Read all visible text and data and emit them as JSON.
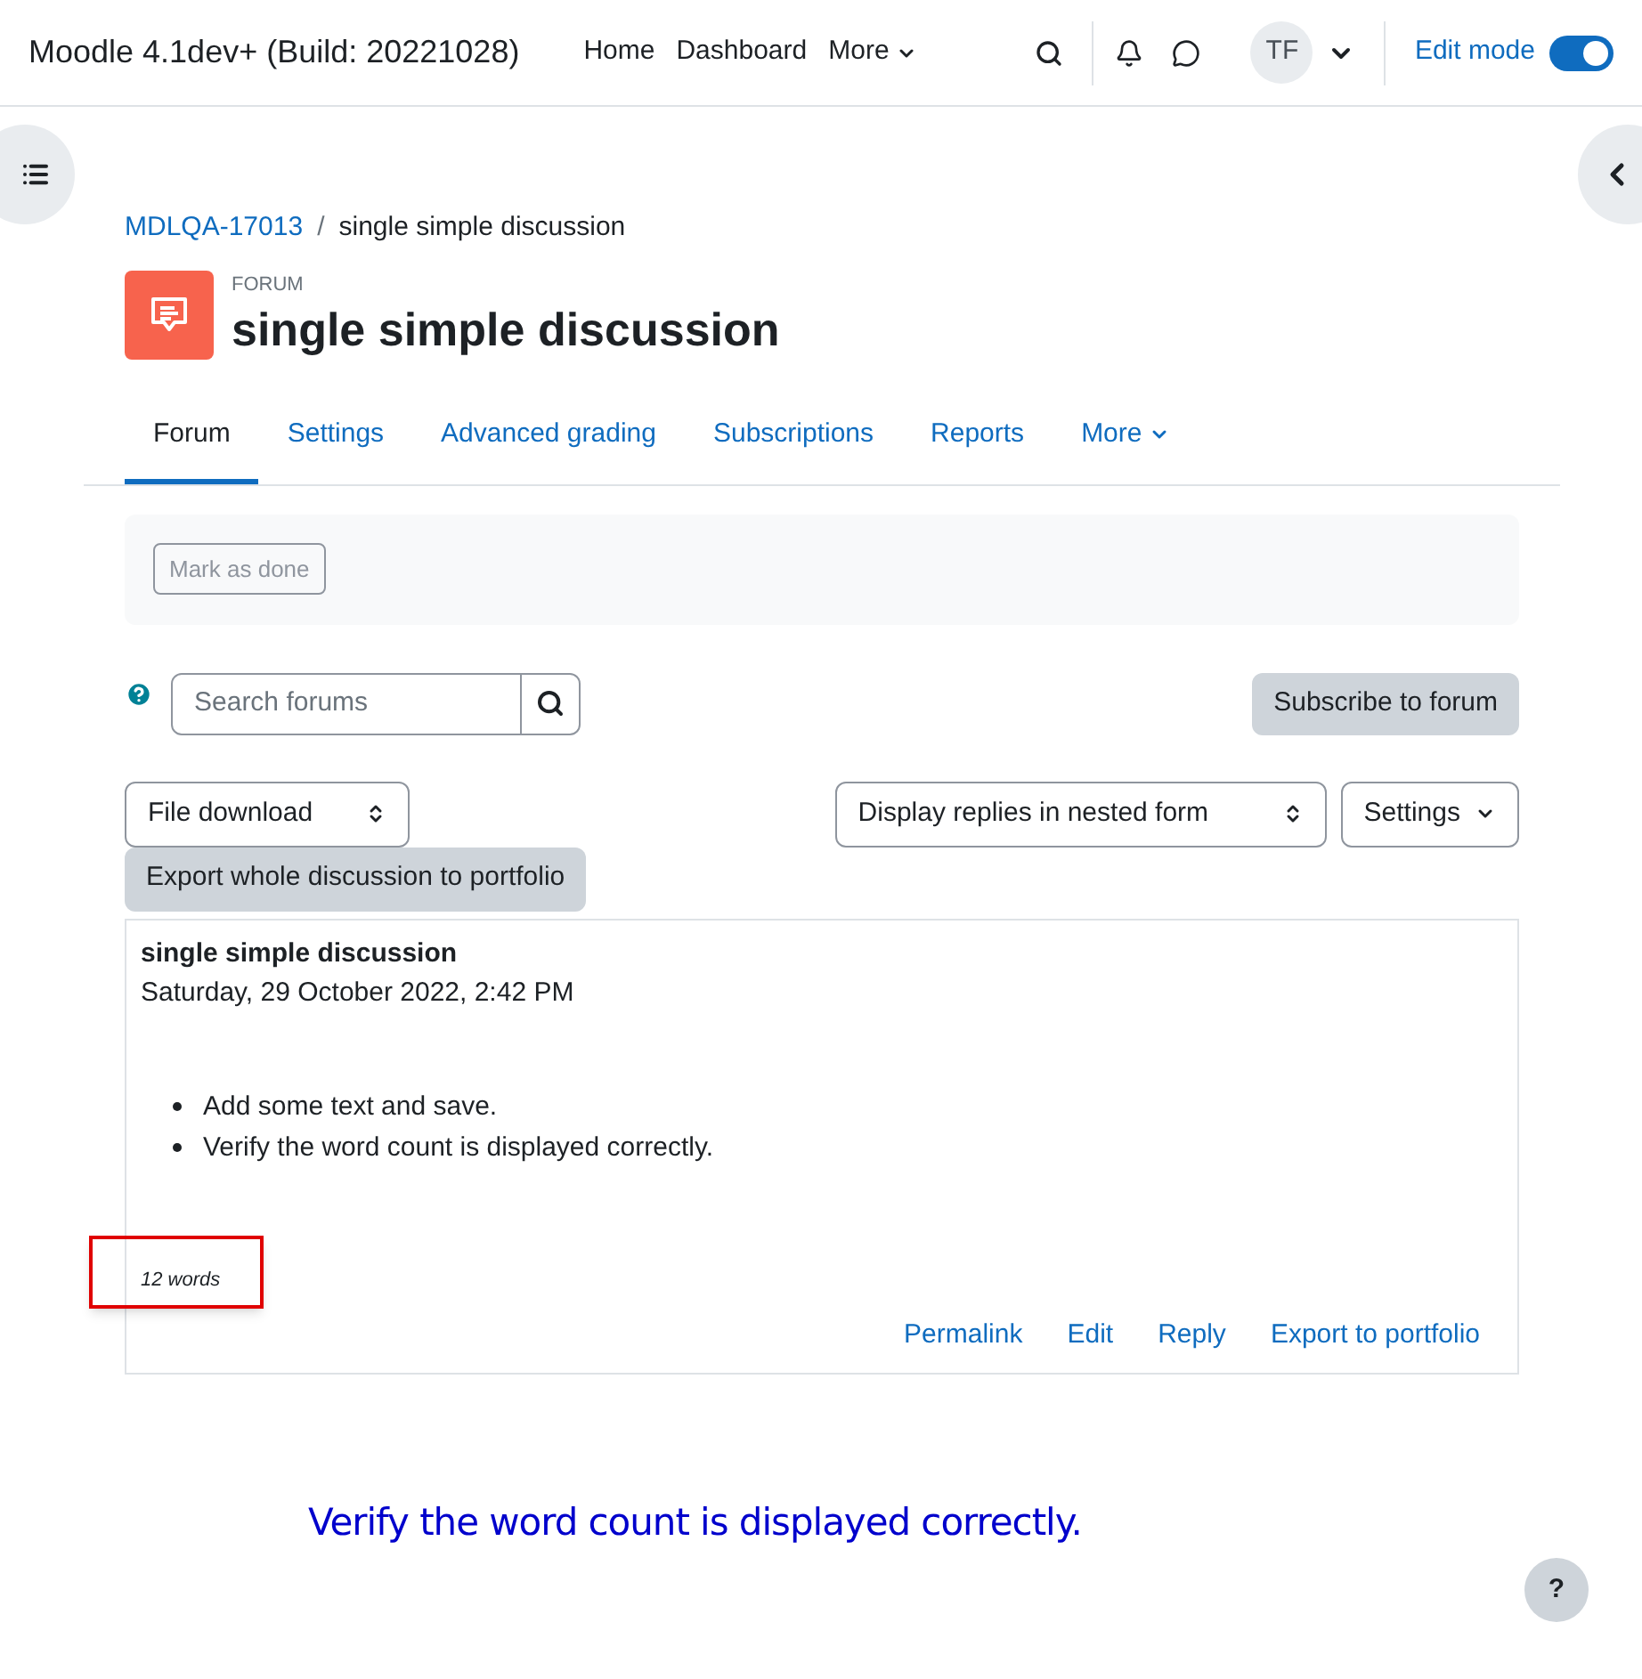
{
  "navbar": {
    "site_name": "Moodle 4.1dev+ (Build: 20221028)",
    "links": [
      {
        "label": "Home",
        "dropdown": false
      },
      {
        "label": "Dashboard",
        "dropdown": false
      },
      {
        "label": "More",
        "dropdown": true
      }
    ],
    "avatar": "TF",
    "edit_mode": {
      "label": "Edit mode",
      "on": true
    }
  },
  "breadcrumb_separator": "/",
  "breadcrumb": [
    {
      "label": "MDLQA-17013",
      "link": true
    },
    {
      "label": "single simple discussion",
      "link": false
    }
  ],
  "header": {
    "module": "FORUM",
    "title": "single simple discussion"
  },
  "tabs": [
    {
      "label": "Forum",
      "selected": true,
      "dropdown": false
    },
    {
      "label": "Settings",
      "selected": false,
      "dropdown": false
    },
    {
      "label": "Advanced grading",
      "selected": false,
      "dropdown": false
    },
    {
      "label": "Subscriptions",
      "selected": false,
      "dropdown": false
    },
    {
      "label": "Reports",
      "selected": false,
      "dropdown": false
    },
    {
      "label": "More",
      "selected": false,
      "dropdown": true
    }
  ],
  "completion": {
    "button": "Mark as done"
  },
  "search": {
    "placeholder": "Search forums"
  },
  "subscribe_button": "Subscribe to forum",
  "file_select": "File download",
  "display_select": "Display replies in nested form",
  "settings_menu": "Settings",
  "export_button": "Export whole discussion to portfolio",
  "post": {
    "subject": "single simple discussion",
    "date": "Saturday, 29 October 2022, 2:42 PM",
    "items": [
      "Add some text and save.",
      "Verify the word count is displayed correctly."
    ],
    "word_count": "12 words",
    "actions": [
      "Permalink",
      "Edit",
      "Reply",
      "Export to portfolio"
    ]
  },
  "annotation": "Verify the word count is displayed correctly.",
  "help_button": "?"
}
